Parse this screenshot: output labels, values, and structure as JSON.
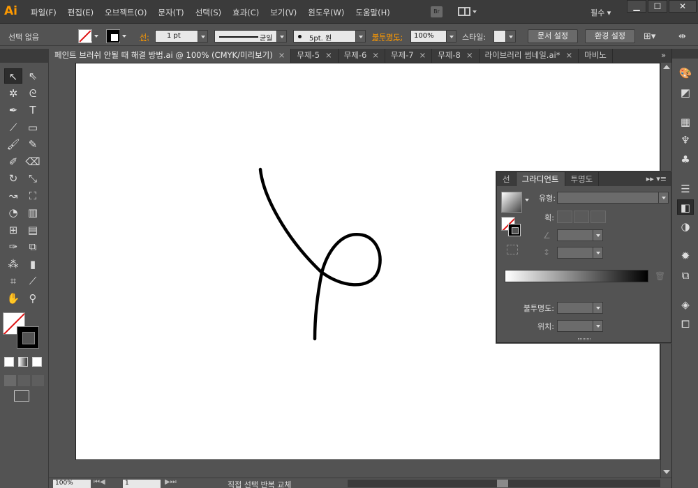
{
  "app": {
    "logo": "Ai"
  },
  "menu": {
    "items": [
      "파일(F)",
      "편집(E)",
      "오브젝트(O)",
      "문자(T)",
      "선택(S)",
      "효과(C)",
      "보기(V)",
      "윈도우(W)",
      "도움말(H)"
    ],
    "bridge": "Br",
    "workspace": "필수"
  },
  "window": {
    "minimize": "▁",
    "maximize": "☐",
    "close": "✕"
  },
  "control": {
    "selection": "선택 없음",
    "stroke_label": "선:",
    "stroke_weight": "1 pt",
    "stroke_profile": "균일",
    "brush": "5pt. 원",
    "opacity_label": "불투명도:",
    "opacity": "100%",
    "style_label": "스타일:",
    "doc_setup": "문서 설정",
    "preferences": "환경 설정"
  },
  "tabs": [
    {
      "label": "페인트 브러쉬 안될 때 해결 방법.ai @ 100% (CMYK/미리보기)",
      "close": "×"
    },
    {
      "label": "무제-5",
      "close": "×"
    },
    {
      "label": "무제-6",
      "close": "×"
    },
    {
      "label": "무제-7",
      "close": "×"
    },
    {
      "label": "무제-8",
      "close": "×"
    },
    {
      "label": "라이브러리 썸네일.ai*",
      "close": "×"
    },
    {
      "label": "마비노",
      "close": ""
    }
  ],
  "tabs_overflow": "»",
  "tools": [
    "selection-tool",
    "direct-selection-tool",
    "magic-wand-tool",
    "lasso-tool",
    "pen-tool",
    "type-tool",
    "line-tool",
    "rectangle-tool",
    "paintbrush-tool",
    "pencil-tool",
    "blob-brush-tool",
    "eraser-tool",
    "rotate-tool",
    "scale-tool",
    "warp-tool",
    "free-transform-tool",
    "shape-builder-tool",
    "graph-tool",
    "mesh-tool",
    "gradient-tool",
    "eyedropper-tool",
    "blend-tool",
    "symbol-sprayer-tool",
    "column-graph-tool",
    "artboard-tool",
    "slice-tool",
    "hand-tool",
    "zoom-tool"
  ],
  "gradient_panel": {
    "tabs": [
      "선",
      "그라디언트",
      "투명도"
    ],
    "type_label": "유형:",
    "stroke_label": "획:",
    "opacity_label": "불투명도:",
    "location_label": "위치:"
  },
  "status": {
    "zoom": "100%",
    "page": "1",
    "text": "직접 선택 반복 교체"
  },
  "colors": {
    "accent": "#ff9a00",
    "ui_dark": "#3b3b3b",
    "ui_mid": "#535353",
    "artboard": "#ffffff"
  },
  "icons": {
    "dock": [
      "color-icon",
      "color-guide-icon",
      "swatches-icon",
      "brushes-icon",
      "symbols-icon",
      "stroke-icon",
      "gradient-icon",
      "transparency-icon",
      "appearance-icon",
      "graphic-styles-icon",
      "layers-icon",
      "artboards-icon"
    ]
  }
}
